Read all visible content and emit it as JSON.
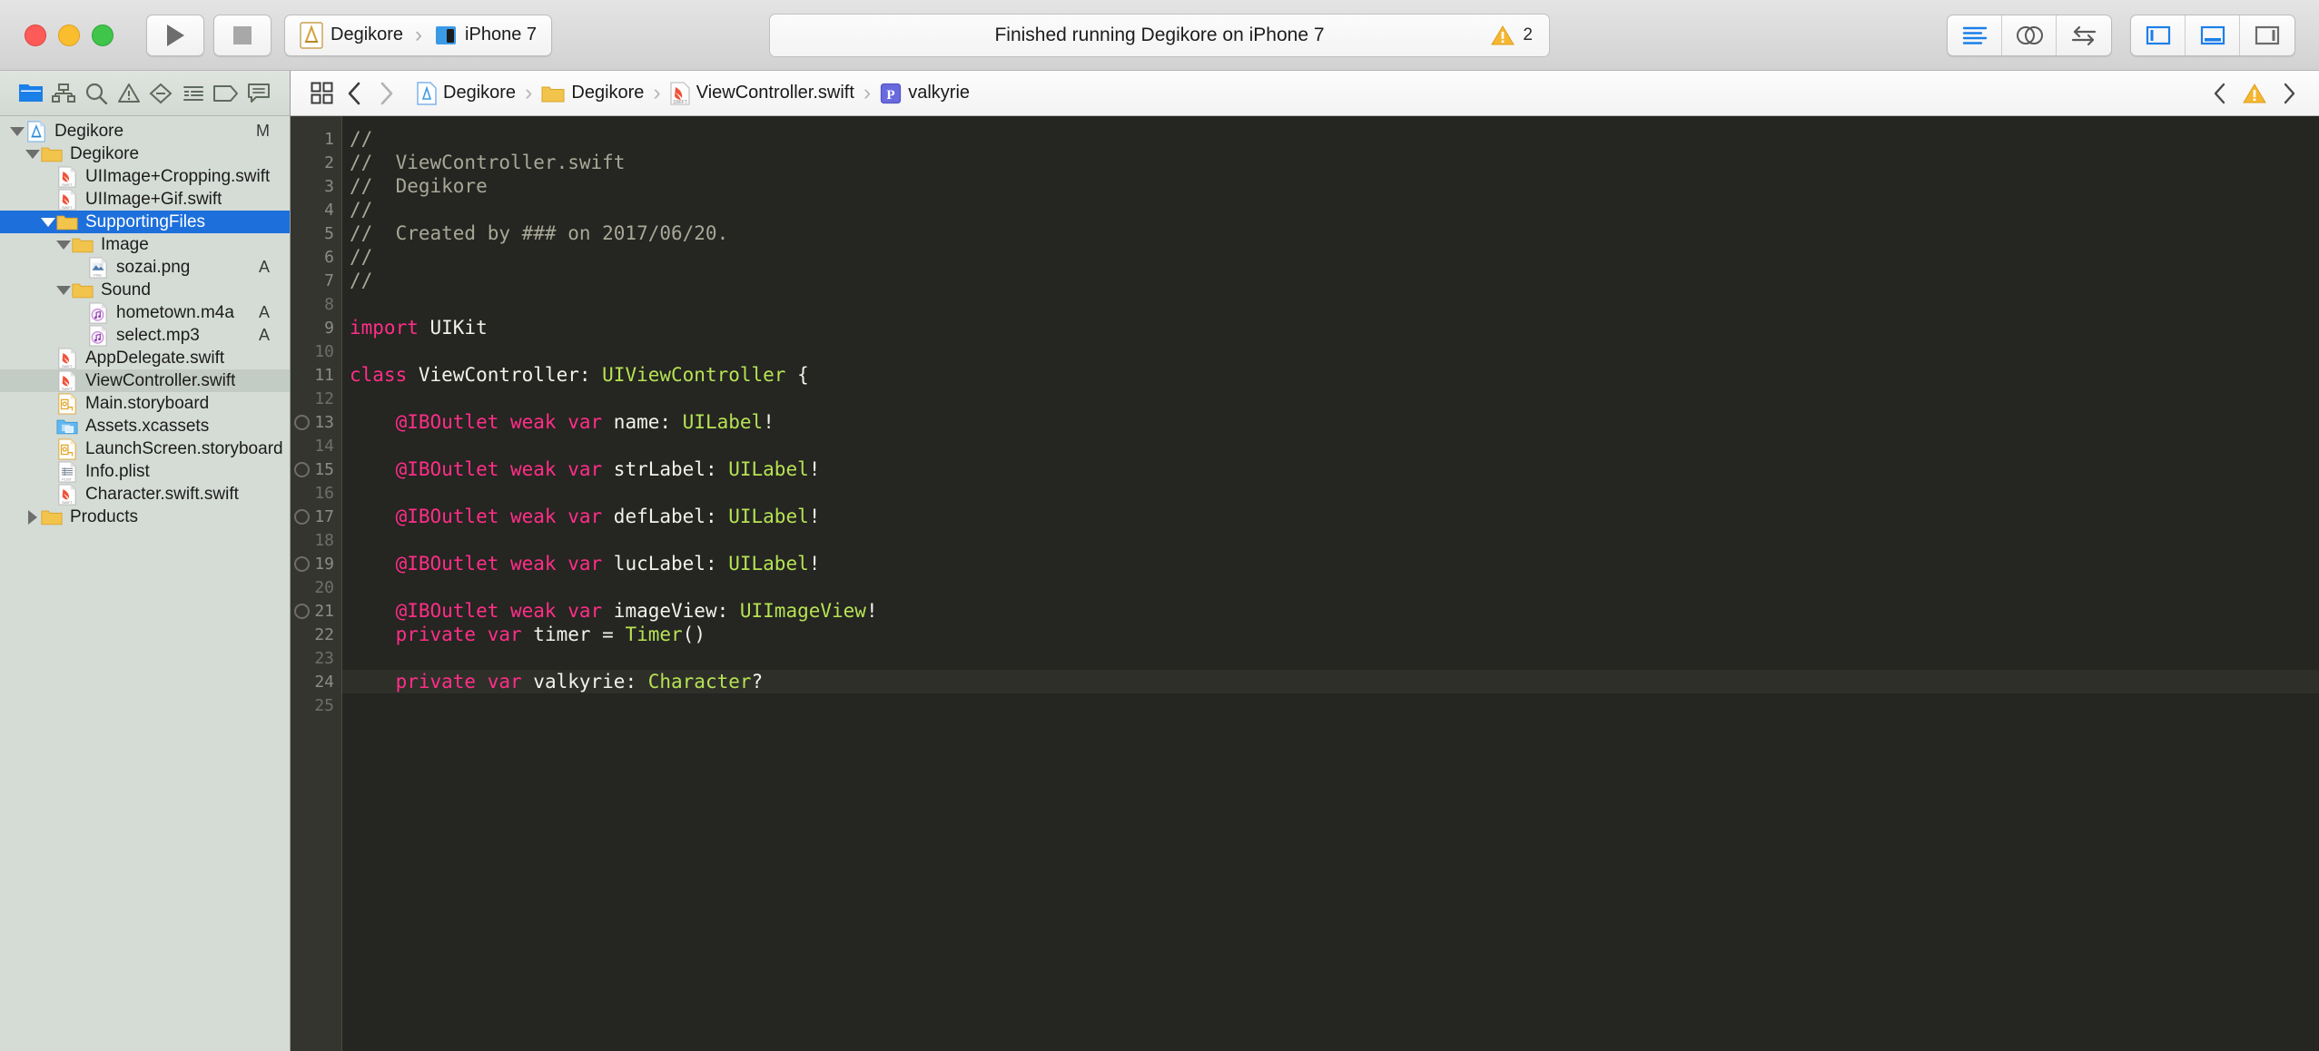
{
  "titlebar": {
    "run_button": "Run",
    "stop_button": "Stop",
    "scheme": {
      "project": "Degikore",
      "destination": "iPhone 7"
    },
    "status": {
      "text": "Finished running Degikore on iPhone 7",
      "warning_count": "2"
    },
    "editor_modes": [
      "standard-editor",
      "assistant-editor",
      "version-editor"
    ],
    "view_toggles": [
      "navigator-toggle",
      "debug-area-toggle",
      "utilities-toggle"
    ]
  },
  "navigator": {
    "toolbar_icons": [
      "project-navigator-icon",
      "source-control-navigator-icon",
      "symbol-navigator-icon",
      "issue-navigator-icon",
      "test-navigator-icon",
      "debug-navigator-icon",
      "breakpoint-navigator-icon",
      "report-navigator-icon"
    ],
    "items": [
      {
        "name": "Degikore",
        "icon": "xcode-project-icon",
        "indent": 0,
        "twisty": "open",
        "badge": "M",
        "state": "normal"
      },
      {
        "name": "Degikore",
        "icon": "folder-icon",
        "indent": 1,
        "twisty": "open",
        "badge": "",
        "state": "normal"
      },
      {
        "name": "UIImage+Cropping.swift",
        "icon": "swift-file-icon",
        "indent": 2,
        "twisty": "none",
        "badge": "",
        "state": "normal"
      },
      {
        "name": "UIImage+Gif.swift",
        "icon": "swift-file-icon",
        "indent": 2,
        "twisty": "none",
        "badge": "",
        "state": "normal"
      },
      {
        "name": "SupportingFiles",
        "icon": "folder-icon",
        "indent": 2,
        "twisty": "open",
        "badge": "",
        "state": "selected"
      },
      {
        "name": "Image",
        "icon": "folder-icon",
        "indent": 3,
        "twisty": "open",
        "badge": "",
        "state": "normal"
      },
      {
        "name": "sozai.png",
        "icon": "png-file-icon",
        "indent": 4,
        "twisty": "none",
        "badge": "A",
        "state": "normal"
      },
      {
        "name": "Sound",
        "icon": "folder-icon",
        "indent": 3,
        "twisty": "open",
        "badge": "",
        "state": "normal"
      },
      {
        "name": "hometown.m4a",
        "icon": "audio-file-icon",
        "indent": 4,
        "twisty": "none",
        "badge": "A",
        "state": "normal"
      },
      {
        "name": "select.mp3",
        "icon": "audio-file-icon",
        "indent": 4,
        "twisty": "none",
        "badge": "A",
        "state": "normal"
      },
      {
        "name": "AppDelegate.swift",
        "icon": "swift-file-icon",
        "indent": 2,
        "twisty": "none",
        "badge": "",
        "state": "normal"
      },
      {
        "name": "ViewController.swift",
        "icon": "swift-file-icon",
        "indent": 2,
        "twisty": "none",
        "badge": "",
        "state": "softsel"
      },
      {
        "name": "Main.storyboard",
        "icon": "storyboard-file-icon",
        "indent": 2,
        "twisty": "none",
        "badge": "",
        "state": "normal"
      },
      {
        "name": "Assets.xcassets",
        "icon": "xcassets-icon",
        "indent": 2,
        "twisty": "none",
        "badge": "",
        "state": "normal"
      },
      {
        "name": "LaunchScreen.storyboard",
        "icon": "storyboard-file-icon",
        "indent": 2,
        "twisty": "none",
        "badge": "",
        "state": "normal"
      },
      {
        "name": "Info.plist",
        "icon": "plist-file-icon",
        "indent": 2,
        "twisty": "none",
        "badge": "",
        "state": "normal"
      },
      {
        "name": "Character.swift.swift",
        "icon": "swift-file-icon",
        "indent": 2,
        "twisty": "none",
        "badge": "",
        "state": "normal"
      },
      {
        "name": "Products",
        "icon": "folder-icon",
        "indent": 1,
        "twisty": "closed",
        "badge": "",
        "state": "normal"
      }
    ]
  },
  "jumpbar": {
    "related_items_icon": "related-items-icon",
    "back_label": "Back",
    "forward_label": "Forward",
    "breadcrumbs": [
      {
        "label": "Degikore",
        "icon": "xcode-project-icon"
      },
      {
        "label": "Degikore",
        "icon": "folder-icon"
      },
      {
        "label": "ViewController.swift",
        "icon": "swift-file-icon"
      },
      {
        "label": "valkyrie",
        "icon": "property-symbol-icon"
      }
    ],
    "issue_prev": "previous-issue",
    "issue_next": "next-issue",
    "issue_badge": "warning-icon"
  },
  "editor": {
    "current_line": 24,
    "lines": [
      {
        "n": 1,
        "breakpoint": false,
        "tokens": [
          {
            "t": "//",
            "c": "cmt"
          }
        ]
      },
      {
        "n": 2,
        "breakpoint": false,
        "tokens": [
          {
            "t": "//  ViewController.swift",
            "c": "cmt"
          }
        ]
      },
      {
        "n": 3,
        "breakpoint": false,
        "tokens": [
          {
            "t": "//  Degikore",
            "c": "cmt"
          }
        ]
      },
      {
        "n": 4,
        "breakpoint": false,
        "tokens": [
          {
            "t": "//",
            "c": "cmt"
          }
        ]
      },
      {
        "n": 5,
        "breakpoint": false,
        "tokens": [
          {
            "t": "//  Created by ### on 2017/06/20.",
            "c": "cmt"
          }
        ]
      },
      {
        "n": 6,
        "breakpoint": false,
        "tokens": [
          {
            "t": "//",
            "c": "cmt"
          }
        ]
      },
      {
        "n": 7,
        "breakpoint": false,
        "tokens": [
          {
            "t": "//",
            "c": "cmt"
          }
        ]
      },
      {
        "n": 8,
        "breakpoint": false,
        "tokens": []
      },
      {
        "n": 9,
        "breakpoint": false,
        "tokens": [
          {
            "t": "import",
            "c": "kw"
          },
          {
            "t": " UIKit",
            "c": "pln"
          }
        ]
      },
      {
        "n": 10,
        "breakpoint": false,
        "tokens": []
      },
      {
        "n": 11,
        "breakpoint": false,
        "tokens": [
          {
            "t": "class",
            "c": "kw"
          },
          {
            "t": " ViewController: ",
            "c": "pln"
          },
          {
            "t": "UIViewController",
            "c": "typ"
          },
          {
            "t": " {",
            "c": "pln"
          }
        ]
      },
      {
        "n": 12,
        "breakpoint": false,
        "tokens": []
      },
      {
        "n": 13,
        "breakpoint": true,
        "tokens": [
          {
            "t": "    @IBOutlet weak var",
            "c": "kw"
          },
          {
            "t": " name: ",
            "c": "pln"
          },
          {
            "t": "UILabel",
            "c": "typ"
          },
          {
            "t": "!",
            "c": "pln"
          }
        ]
      },
      {
        "n": 14,
        "breakpoint": false,
        "tokens": []
      },
      {
        "n": 15,
        "breakpoint": true,
        "tokens": [
          {
            "t": "    @IBOutlet weak var",
            "c": "kw"
          },
          {
            "t": " strLabel: ",
            "c": "pln"
          },
          {
            "t": "UILabel",
            "c": "typ"
          },
          {
            "t": "!",
            "c": "pln"
          }
        ]
      },
      {
        "n": 16,
        "breakpoint": false,
        "tokens": []
      },
      {
        "n": 17,
        "breakpoint": true,
        "tokens": [
          {
            "t": "    @IBOutlet weak var",
            "c": "kw"
          },
          {
            "t": " defLabel: ",
            "c": "pln"
          },
          {
            "t": "UILabel",
            "c": "typ"
          },
          {
            "t": "!",
            "c": "pln"
          }
        ]
      },
      {
        "n": 18,
        "breakpoint": false,
        "tokens": []
      },
      {
        "n": 19,
        "breakpoint": true,
        "tokens": [
          {
            "t": "    @IBOutlet weak var",
            "c": "kw"
          },
          {
            "t": " lucLabel: ",
            "c": "pln"
          },
          {
            "t": "UILabel",
            "c": "typ"
          },
          {
            "t": "!",
            "c": "pln"
          }
        ]
      },
      {
        "n": 20,
        "breakpoint": false,
        "tokens": []
      },
      {
        "n": 21,
        "breakpoint": true,
        "tokens": [
          {
            "t": "    @IBOutlet weak var",
            "c": "kw"
          },
          {
            "t": " imageView: ",
            "c": "pln"
          },
          {
            "t": "UIImageView",
            "c": "typ"
          },
          {
            "t": "!",
            "c": "pln"
          }
        ]
      },
      {
        "n": 22,
        "breakpoint": false,
        "tokens": [
          {
            "t": "    private var",
            "c": "kw"
          },
          {
            "t": " timer = ",
            "c": "pln"
          },
          {
            "t": "Timer",
            "c": "typ"
          },
          {
            "t": "()",
            "c": "pln"
          }
        ]
      },
      {
        "n": 23,
        "breakpoint": false,
        "tokens": []
      },
      {
        "n": 24,
        "breakpoint": false,
        "tokens": [
          {
            "t": "    private var",
            "c": "kw"
          },
          {
            "t": " valkyrie: ",
            "c": "pln"
          },
          {
            "t": "Character",
            "c": "typ"
          },
          {
            "t": "?",
            "c": "pln"
          }
        ]
      },
      {
        "n": 25,
        "breakpoint": false,
        "tokens": []
      }
    ]
  },
  "colors": {
    "selection_blue": "#1d6fdb",
    "editor_bg": "#252521",
    "gutter_bg": "#35352f",
    "keyword_pink": "#ff2e88",
    "type_green": "#b6e354",
    "comment_gray": "#a8a898",
    "warning_yellow": "#f5b731"
  }
}
